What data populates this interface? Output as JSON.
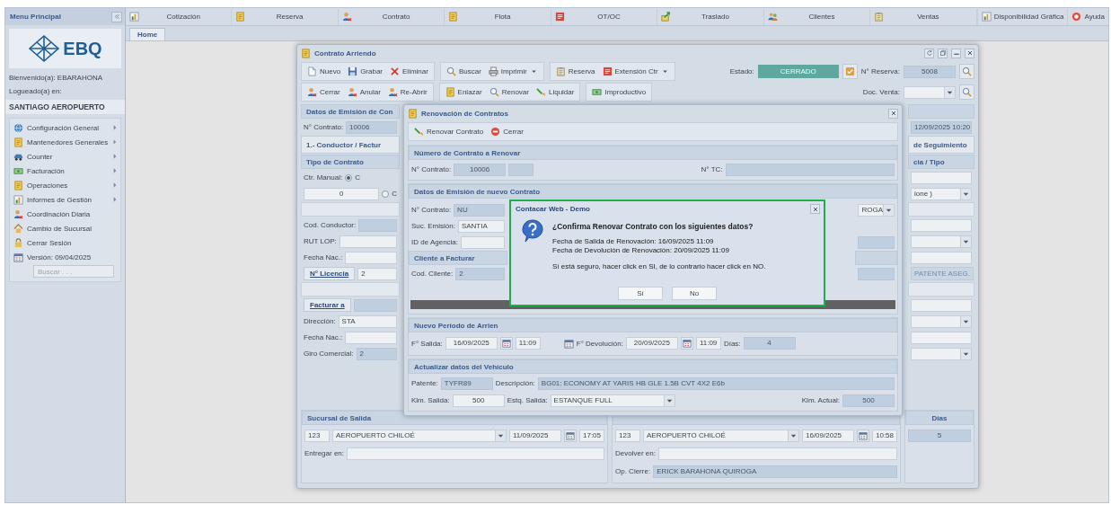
{
  "sidebar": {
    "title": "Menu Principal",
    "logo_text": "EBQ",
    "welcome": "Bienvenido(a): EBARAHONA",
    "logged_label": "Logueado(a) en:",
    "branch": "SANTIAGO AEROPUERTO",
    "items": [
      {
        "label": "Configuración General",
        "submenu": true
      },
      {
        "label": "Mantenedores Generales",
        "submenu": true
      },
      {
        "label": "Counter",
        "submenu": true
      },
      {
        "label": "Facturación",
        "submenu": true
      },
      {
        "label": "Operaciones",
        "submenu": true
      },
      {
        "label": "Informes de Gestión",
        "submenu": true
      },
      {
        "label": "Coordinación Diaria",
        "submenu": false
      },
      {
        "label": "Cambio de Sucursal",
        "submenu": false
      },
      {
        "label": "Cerrar Sesión",
        "submenu": false
      },
      {
        "label": "Versión: 09/04/2025",
        "submenu": false
      }
    ],
    "search": {
      "placeholder": "Buscar . . ."
    }
  },
  "top_menu": {
    "items": [
      "Cotización",
      "Reserva",
      "Contrato",
      "Flota",
      "OT/OC",
      "Traslado",
      "Clientes",
      "Ventas"
    ],
    "right_items": [
      "Disponibilidad Gráfica",
      "Ayuda"
    ]
  },
  "tabs": [
    {
      "label": "Home",
      "selected": true
    }
  ],
  "contract_window": {
    "title": "Contrato Arriendo",
    "toolbar_rows": [
      [
        [
          {
            "label": "Nuevo",
            "has_menu": false
          },
          {
            "label": "Grabar",
            "has_menu": false
          },
          {
            "label": "Eliminar",
            "has_menu": false
          }
        ],
        [
          {
            "label": "Buscar",
            "has_menu": false
          },
          {
            "label": "Imprimir",
            "has_menu": true
          }
        ],
        [
          {
            "label": "Reserva",
            "has_menu": false
          },
          {
            "label": "Extensión Ctr",
            "has_menu": true
          }
        ]
      ],
      [
        [
          {
            "label": "Cerrar",
            "has_menu": false
          },
          {
            "label": "Anular",
            "has_menu": false
          },
          {
            "label": "Re-Abrir",
            "has_menu": false
          }
        ],
        [
          {
            "label": "Enlazar",
            "has_menu": false
          },
          {
            "label": "Renovar",
            "has_menu": false
          },
          {
            "label": "Liquidar",
            "has_menu": false
          }
        ],
        [
          {
            "label": "Improductivo",
            "has_menu": false
          }
        ]
      ]
    ],
    "status_label": "Estado:",
    "status": "CERRADO",
    "reservation_label": "N° Reserva:",
    "reservation": "5008",
    "sale_doc_label": "Doc. Venta:",
    "left_rows": [
      {
        "kind": "header",
        "label": "Datos de Emisión de Con"
      },
      {
        "kind": "field",
        "label": "N° Contrato:",
        "value": "10006",
        "readonly": true
      },
      {
        "kind": "tab",
        "label": "1.- Conductor / Factur"
      },
      {
        "kind": "header",
        "label": "Tipo de Contrato"
      },
      {
        "kind": "radio",
        "label": "Ctr. Manual:",
        "option": "C",
        "selected": true
      },
      {
        "kind": "radio",
        "value": "0",
        "readonly": false,
        "option": "C",
        "selected": false
      },
      {
        "kind": "band"
      },
      {
        "kind": "field",
        "label": "Cod. Conductor:",
        "readonly": true
      },
      {
        "kind": "field",
        "label": "RUT LOP:",
        "readonly": false
      },
      {
        "kind": "field",
        "label": "Fecha Nac.:",
        "readonly": false
      },
      {
        "kind": "link",
        "label": "N° Licencia",
        "value": "2",
        "readonly": false
      },
      {
        "kind": "band"
      },
      {
        "kind": "link",
        "label": "Facturar a",
        "readonly": true
      },
      {
        "kind": "field",
        "label": "Dirección:",
        "value": "STA",
        "readonly": false
      },
      {
        "kind": "field",
        "label": "Fecha Nac.:",
        "readonly": false
      },
      {
        "kind": "field",
        "label": "Giro Comercial:",
        "value": "2",
        "readonly": true
      }
    ],
    "right_rows": [
      {
        "kind": "header"
      },
      {
        "kind": "field",
        "value": "12/09/2025 10:20",
        "readonly": true
      },
      {
        "kind": "tab",
        "label": "de Seguimiento"
      },
      {
        "kind": "header",
        "label": "cia / Tipo"
      },
      {
        "kind": "field",
        "readonly": false
      },
      {
        "kind": "select",
        "value": "ione )"
      },
      {
        "kind": "band"
      },
      {
        "kind": "field",
        "readonly": false
      },
      {
        "kind": "select"
      },
      {
        "kind": "field",
        "readonly": false
      },
      {
        "kind": "button",
        "label": "PATENTE ASEG."
      },
      {
        "kind": "band"
      },
      {
        "kind": "field",
        "readonly": false
      },
      {
        "kind": "select"
      },
      {
        "kind": "field",
        "readonly": false
      },
      {
        "kind": "select"
      }
    ],
    "departure": {
      "title": "Sucursal de Salida",
      "code": "123",
      "branch": "AEROPUERTO CHILOÉ",
      "date": "11/09/2025",
      "time": "17:05",
      "deliver_label": "Entregar en:"
    },
    "return": {
      "code": "123",
      "branch": "AEROPUERTO CHILOÉ",
      "date": "16/09/2025",
      "time": "10:58",
      "return_label": "Devolver en:",
      "closer_label": "Op. Cierre:",
      "closer": "ERICK BARAHONA QUIROGA"
    },
    "days": {
      "title": "Días",
      "value": "5"
    }
  },
  "renewal_window": {
    "title": "Renovación de Contratos",
    "toolbar": [
      "Renovar Contrato",
      "Cerrar"
    ],
    "contract_section": {
      "title": "Número de Contrato a Renovar",
      "contract_label": "N° Contrato:",
      "contract_value": "10006",
      "tc_label": "N° TC:"
    },
    "issue_section": {
      "title": "Datos de Emisión de nuevo Contrato",
      "left_rows": [
        {
          "kind": "field",
          "label": "N° Contrato:",
          "value": "NU",
          "readonly": true
        },
        {
          "kind": "field",
          "label": "Suc. Emisión:",
          "value": "SANTIA",
          "readonly": false
        },
        {
          "kind": "field",
          "label": "ID de Agencia:",
          "readonly": false
        },
        {
          "kind": "header",
          "label": "Cliente a Facturar"
        },
        {
          "kind": "field",
          "label": "Cod. Cliente:",
          "value": "2",
          "readonly": true
        }
      ],
      "right_rows": [
        {
          "kind": "select",
          "value": "ROGA"
        },
        {
          "kind": "blank"
        },
        {
          "kind": "field",
          "readonly": true
        },
        {
          "kind": "header"
        },
        {
          "kind": "field",
          "readonly": true
        }
      ]
    },
    "period_section": {
      "title": "Nuevo Período de Arrien",
      "out_label": "F° Salida:",
      "out_date": "16/09/2025",
      "out_time": "11:09",
      "in_label": "F° Devolución:",
      "in_date": "20/09/2025",
      "in_time": "11:09",
      "days_label": "Días:",
      "days": "4"
    },
    "vehicle_section": {
      "title": "Actualizar datos del Vehículo",
      "plate_label": "Patente:",
      "plate": "TYFR89",
      "desc_label": "Descripción:",
      "desc": "BG01: ECONOMY AT YARIS HB GLE 1.5B CVT 4X2 E6b",
      "km_out_label": "Klm. Salida:",
      "km_out": "500",
      "tank_label": "Estq. Salida:",
      "tank": "ESTANQUE FULL",
      "km_now_label": "Klm. Actual:",
      "km_now": "500"
    }
  },
  "confirm_dialog": {
    "title": "Contacar Web - Demo",
    "question": "¿Confirma Renovar Contrato con los siguientes datos?",
    "lines": [
      "Fecha de Salida de Renovación: 16/09/2025 11:09",
      "Fecha de Devolución de Renovación: 20/09/2025 11:09"
    ],
    "note": "Sí está seguro, hacer click en SI, de lo contrario hacer click en NO.",
    "buttons": [
      "Sí",
      "No"
    ]
  }
}
